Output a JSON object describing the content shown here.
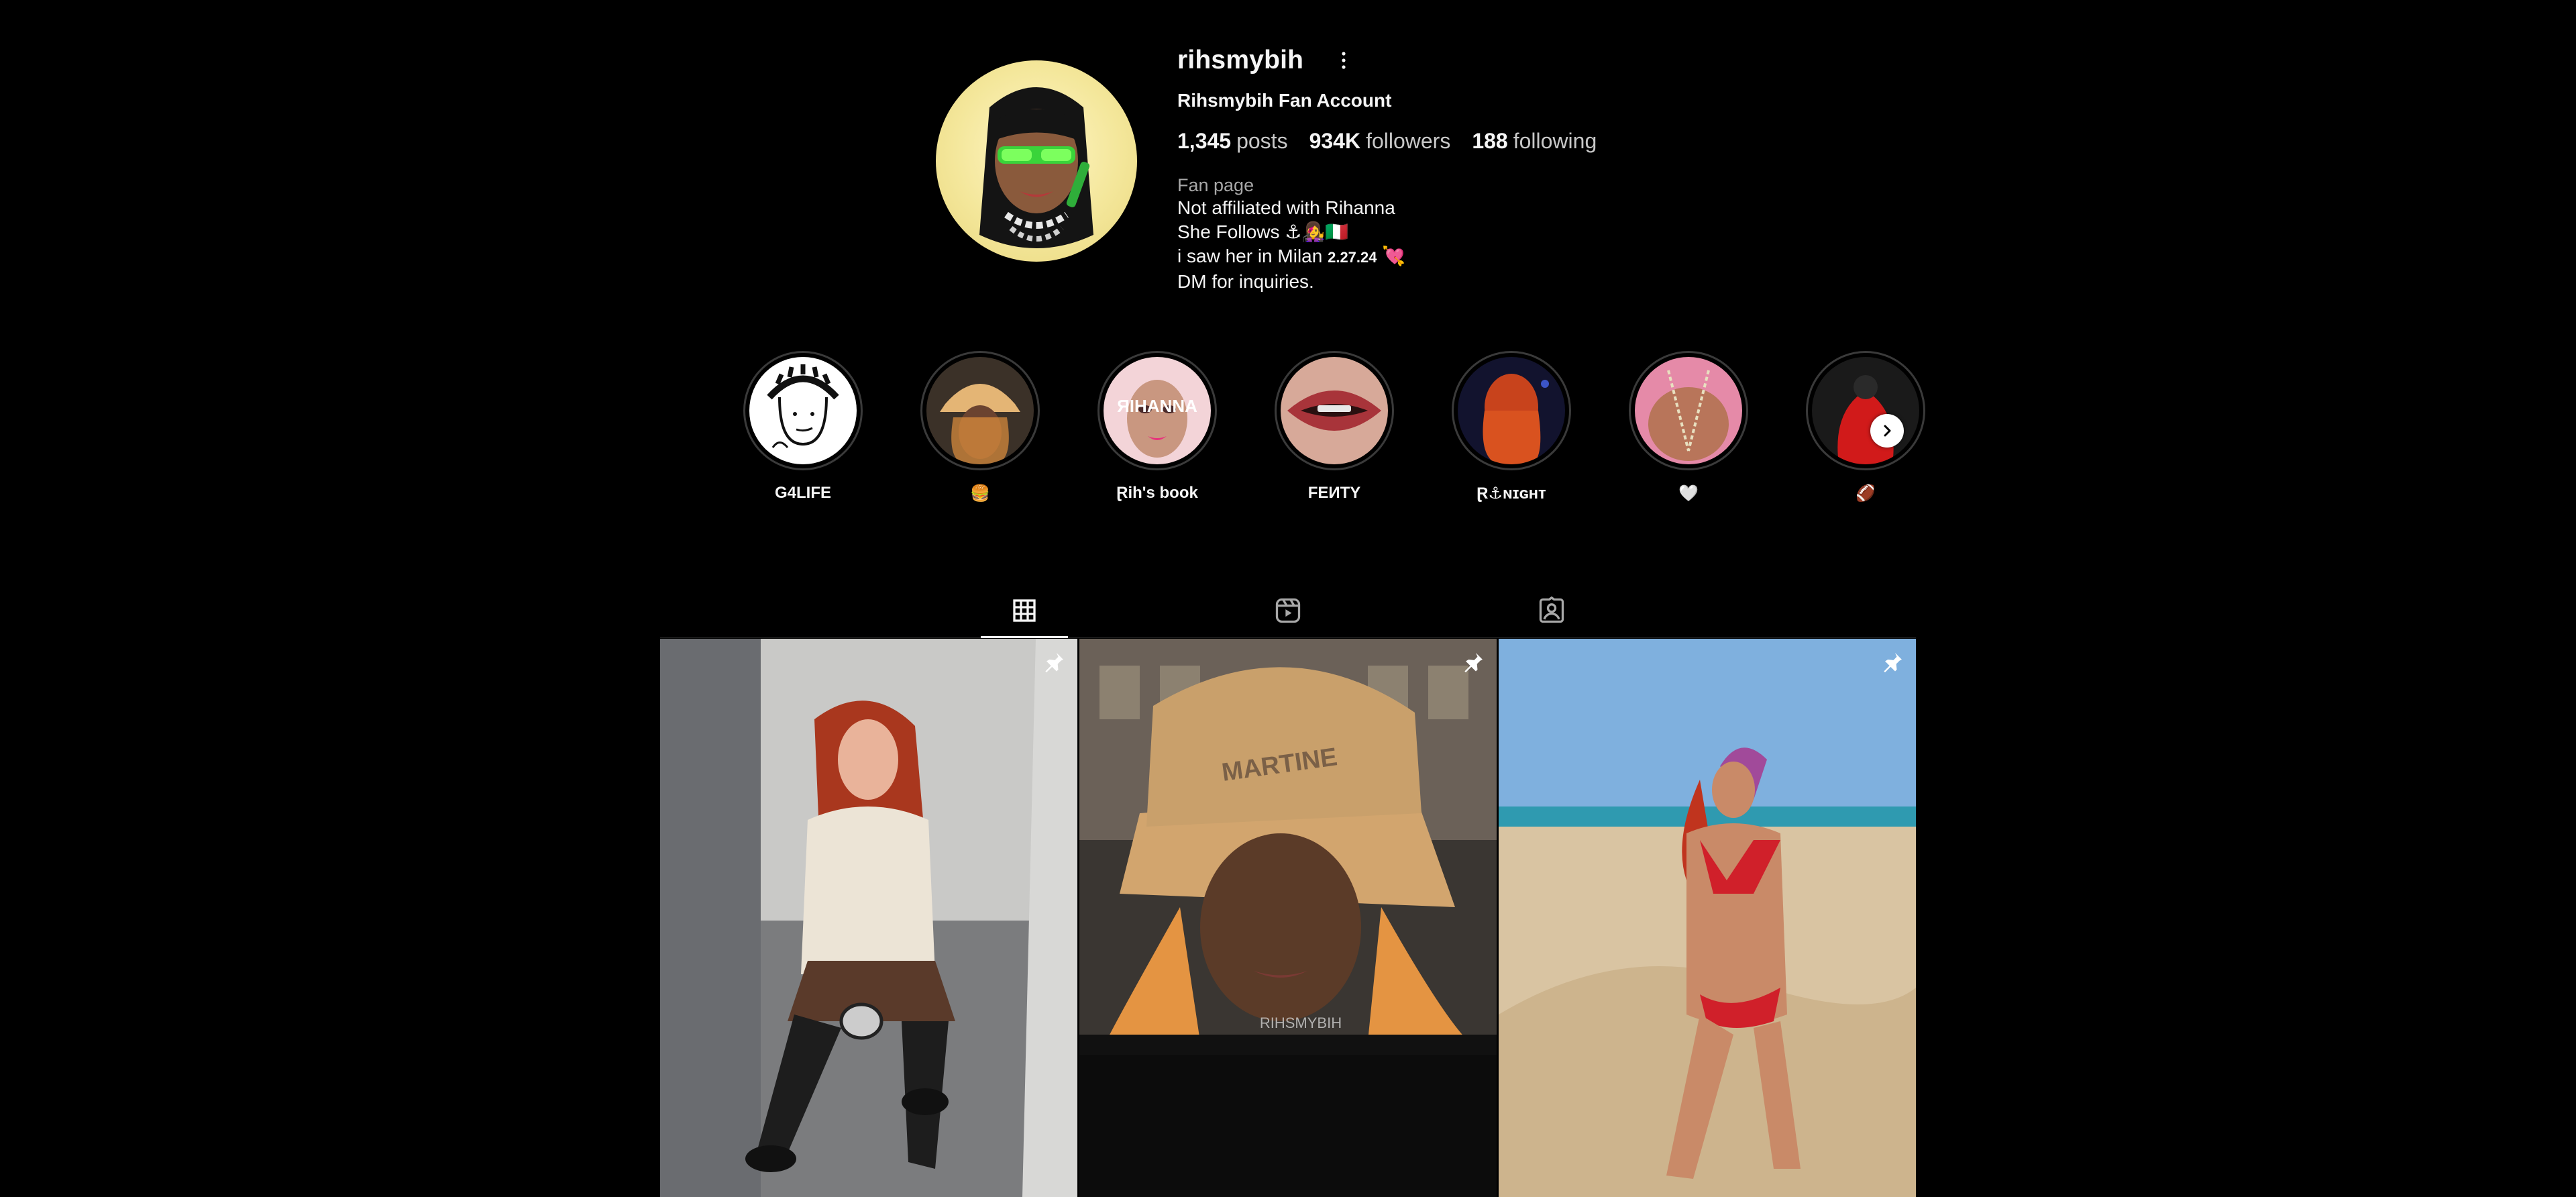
{
  "profile": {
    "username": "rihsmybih",
    "full_name": "Rihsmybih Fan Account",
    "stats": {
      "posts_count": "1,345",
      "posts_label": "posts",
      "followers_count": "934K",
      "followers_label": "followers",
      "following_count": "188",
      "following_label": "following"
    },
    "category": "Fan page",
    "bio": {
      "line1": "Not affiliated with Rihanna",
      "line2": "She Follows ⚓👩‍🎤🇮🇹",
      "line3_text": "i saw her in Milan ",
      "line3_date": "2.27.24",
      "line3_emoji": " 💘",
      "line4": "DM for inquiries."
    }
  },
  "highlights": [
    {
      "label": "G4LIFE"
    },
    {
      "label": "🍔"
    },
    {
      "label": "Ɽih's book"
    },
    {
      "label": "FEИTY"
    },
    {
      "label": "Ɽ⚓ɴɪɢʜᴛ"
    },
    {
      "label": "🤍"
    },
    {
      "label": "🏈"
    }
  ],
  "highlight_art": {
    "book_banner": "ЯIHANNA",
    "icon": "chevron-right-icon"
  },
  "tabs": [
    {
      "name": "posts",
      "icon": "grid-icon",
      "active": true
    },
    {
      "name": "reels",
      "icon": "reels-icon",
      "active": false
    },
    {
      "name": "tagged",
      "icon": "tagged-icon",
      "active": false
    }
  ],
  "posts": [
    {
      "pinned": true,
      "icon": "pin-icon"
    },
    {
      "pinned": true,
      "icon": "pin-icon",
      "watermark": "RIHSMYBIH",
      "cap_text": "MARTINE"
    },
    {
      "pinned": true,
      "icon": "pin-icon"
    }
  ],
  "colors": {
    "background": "#000000",
    "text_primary": "#f5f5f5",
    "text_secondary": "#a8a8a8",
    "divider": "#262626"
  }
}
